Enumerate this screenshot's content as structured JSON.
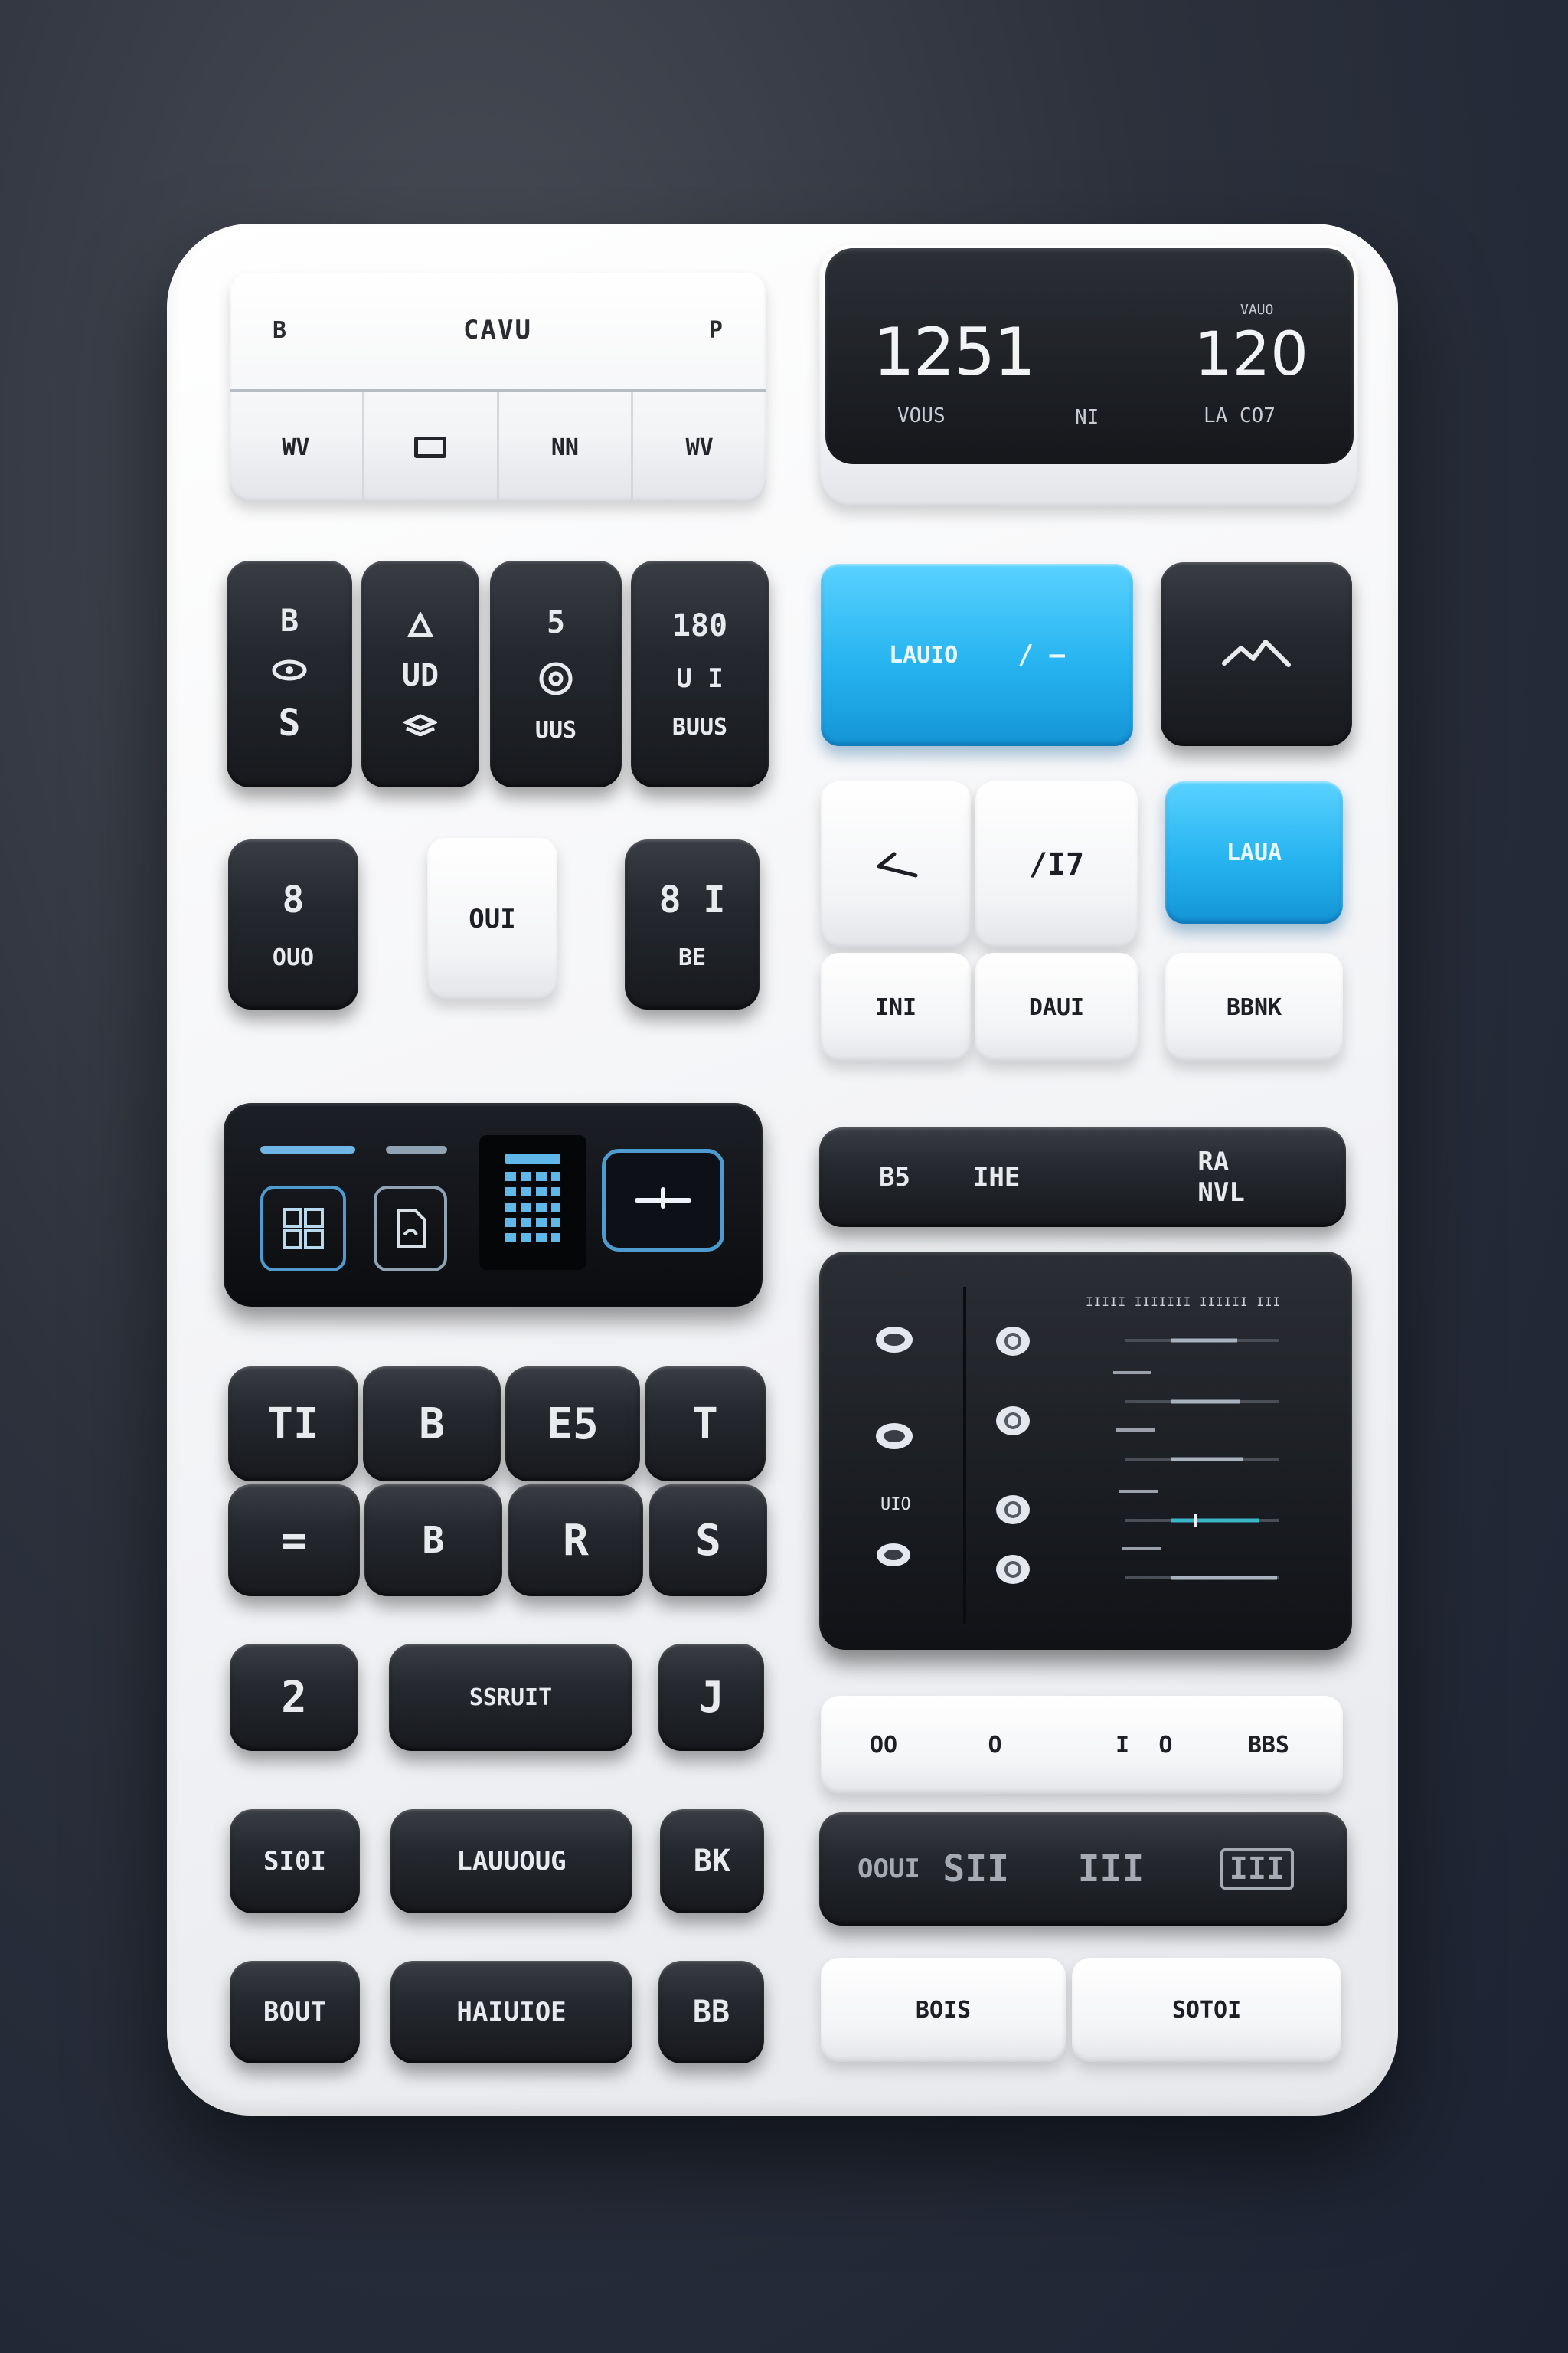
{
  "colors": {
    "accent": "#26b4f0",
    "dark_key": "#1f2228",
    "light_key": "#f3f4f6",
    "panel": "#eef0f3"
  },
  "top_left": {
    "title": "CAVU",
    "left_mark": "B",
    "right_mark": "P",
    "tabs": [
      "WV",
      "",
      "NN",
      "WV"
    ]
  },
  "display": {
    "main_value": "1251",
    "second_value": "120",
    "top_label": "VAUO",
    "bottom_left": "VOUS",
    "bottom_mid": "NI",
    "bottom_right": "LA CO7"
  },
  "key_grid": {
    "k1": {
      "top": "B",
      "mid": "S"
    },
    "k2": {
      "mid": "UD"
    },
    "k3": {
      "top": "5",
      "bottom": "UUS"
    },
    "k4": {
      "top": "180",
      "mid": "U I",
      "bottom": "BUUS"
    }
  },
  "blue_wide": {
    "left": "LAUIO",
    "right": "/ —"
  },
  "small_keys": {
    "k1": {
      "top": "8",
      "bottom": "OUO"
    },
    "k2": "OUI",
    "k3": {
      "top": "8 I",
      "bottom": "BE"
    }
  },
  "light_grid": {
    "k2": "/I7",
    "blue": "LAUA",
    "bottom": [
      "INI",
      "DAUI",
      "BBNK"
    ]
  },
  "dark_toolbar": {
    "left": "B5",
    "mid": "IHE",
    "right": "RA NVL"
  },
  "glyph_keys": [
    "TI",
    "B",
    "E5",
    "T",
    "=",
    "B",
    "R",
    "S"
  ],
  "mini_screen": {
    "dots_left_label": "UIO",
    "header": "IIIII IIIIIII IIIIII III",
    "sliders": [
      0.68,
      0.7,
      0.72,
      0.82,
      0.94
    ]
  },
  "bottom_rows": [
    {
      "left": "2",
      "mid": "SSRUIT",
      "right": "J"
    },
    {
      "left": "SI0I",
      "mid": "LAUUOUG",
      "right": "BK"
    },
    {
      "left": "BOUT",
      "mid": "HAIUIOE",
      "right": "BB"
    }
  ],
  "light_bar": {
    "items": [
      "OO",
      "O",
      "I",
      "O",
      "BBS"
    ]
  },
  "dark_bar": {
    "items": [
      "OOUI",
      "SII",
      "III",
      "III"
    ]
  },
  "bottom_buttons": {
    "left": "BOIS",
    "right": "SOTOI"
  }
}
